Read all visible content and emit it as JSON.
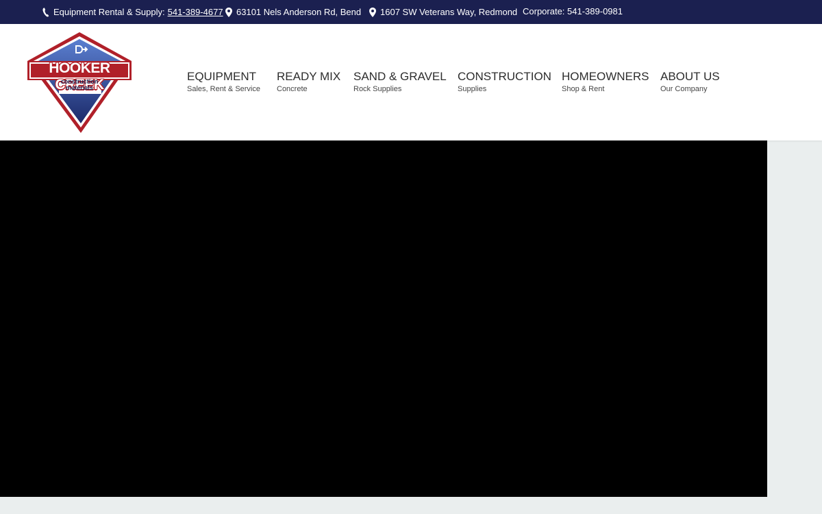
{
  "topbar": {
    "equipment_label": "Equipment Rental & Supply:",
    "equipment_phone": "541-389-4677",
    "address_bend": "63101 Nels Anderson Rd, Bend",
    "address_redmond": "1607 SW Veterans Way, Redmond",
    "corporate": "Corporate: 541-389-0981",
    "icons": [
      "phone-icon",
      "map-pin-icon",
      "map-pin-icon"
    ]
  },
  "logo": {
    "main": "HOOKER CREEK",
    "sub_line1": "construction",
    "sub_line2": "materials",
    "colors": {
      "red": "#b02029",
      "blue": "#3e5fb0",
      "navy": "#1b2050"
    }
  },
  "nav": [
    {
      "label": "EQUIPMENT",
      "sub": "Sales, Rent & Service"
    },
    {
      "label": "READY MIX",
      "sub": "Concrete"
    },
    {
      "label": "SAND & GRAVEL",
      "sub": "Rock Supplies"
    },
    {
      "label": "CONSTRUCTION",
      "sub": "Supplies"
    },
    {
      "label": "HOMEOWNERS",
      "sub": "Shop & Rent"
    },
    {
      "label": "ABOUT US",
      "sub": "Our Company"
    }
  ],
  "colors": {
    "topbar_bg": "#1b2050",
    "page_bg": "#eaeeee",
    "video_bg": "#000000"
  }
}
